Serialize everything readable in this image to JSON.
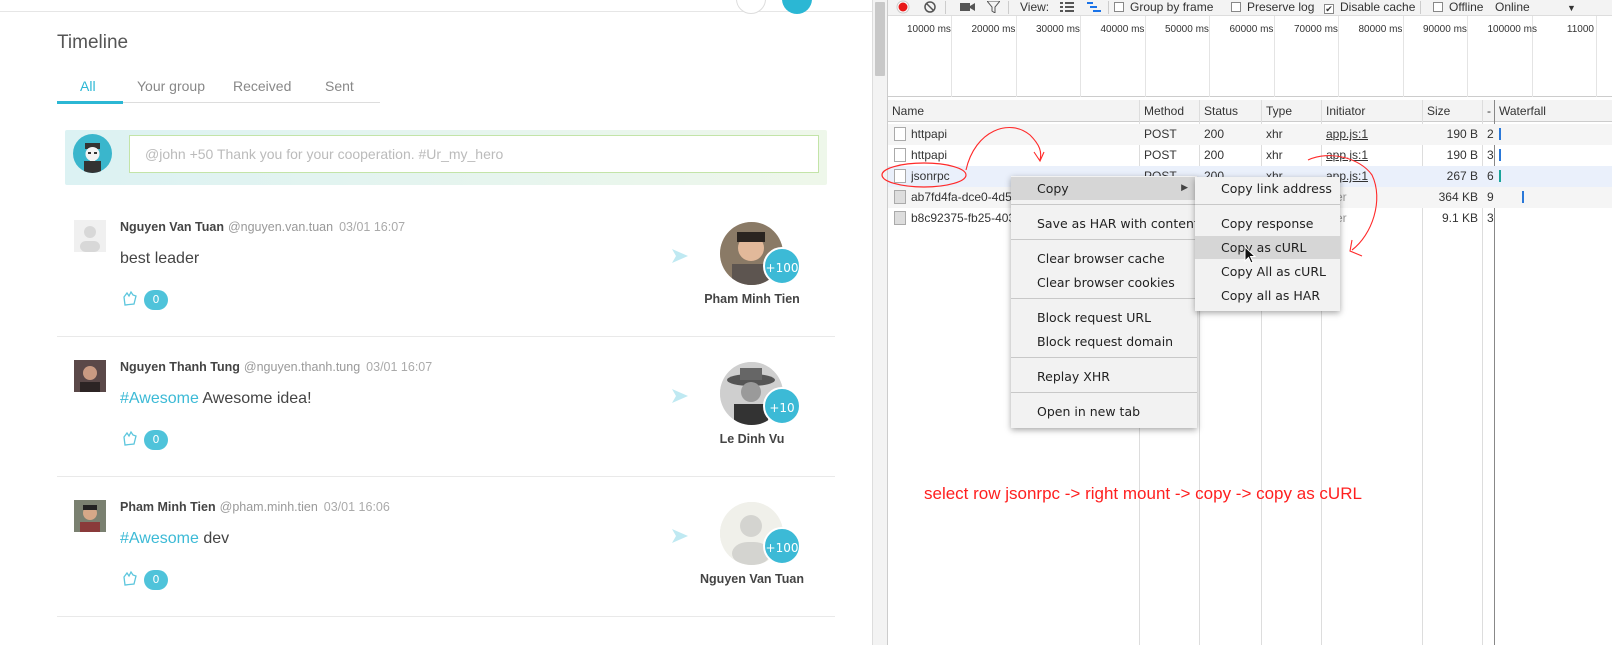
{
  "timeline": {
    "title": "Timeline",
    "tabs": [
      {
        "label": "All",
        "active": true
      },
      {
        "label": "Your group"
      },
      {
        "label": "Received"
      },
      {
        "label": "Sent"
      }
    ],
    "composer_placeholder": "@john +50 Thank you for your cooperation. #Ur_my_hero",
    "posts": [
      {
        "author": "Nguyen Van Tuan",
        "handle": "@nguyen.van.tuan",
        "time": "03/01 16:07",
        "tag": "",
        "message": "best leader",
        "claps": "0",
        "points": "+100",
        "recipient": "Pham Minh Tien"
      },
      {
        "author": "Nguyen Thanh Tung",
        "handle": "@nguyen.thanh.tung",
        "time": "03/01 16:07",
        "tag": "#Awesome",
        "message": "Awesome idea!",
        "claps": "0",
        "points": "+10",
        "recipient": "Le Dinh Vu"
      },
      {
        "author": "Pham Minh Tien",
        "handle": "@pham.minh.tien",
        "time": "03/01 16:06",
        "tag": "#Awesome",
        "message": "dev",
        "claps": "0",
        "points": "+100",
        "recipient": "Nguyen Van Tuan"
      }
    ]
  },
  "devtools": {
    "toolbar": {
      "view_label": "View:",
      "group_by_frame": "Group by frame",
      "preserve_log": "Preserve log",
      "disable_cache": "Disable cache",
      "disable_cache_checked": true,
      "offline": "Offline",
      "throttle": "Online"
    },
    "overview_ticks": [
      "10000 ms",
      "20000 ms",
      "30000 ms",
      "40000 ms",
      "50000 ms",
      "60000 ms",
      "70000 ms",
      "80000 ms",
      "90000 ms",
      "100000 ms",
      "11000"
    ],
    "columns": {
      "name": "Name",
      "method": "Method",
      "status": "Status",
      "type": "Type",
      "initiator": "Initiator",
      "size": "Size",
      "time": "-",
      "waterfall": "Waterfall"
    },
    "rows": [
      {
        "name": "httpapi",
        "method": "POST",
        "status": "200",
        "type": "xhr",
        "initiator": "app.js:1",
        "size": "190 B",
        "time": "2"
      },
      {
        "name": "httpapi",
        "method": "POST",
        "status": "200",
        "type": "xhr",
        "initiator": "app.js:1",
        "size": "190 B",
        "time": "3"
      },
      {
        "name": "jsonrpc",
        "method": "POST",
        "status": "200",
        "type": "xhr",
        "initiator": "app.js:1",
        "size": "267 B",
        "time": "6"
      },
      {
        "name": "ab7fd4fa-dce0-4d5",
        "method": "",
        "status": "",
        "type": "",
        "initiator": "ther",
        "size": "364 KB",
        "time": "9"
      },
      {
        "name": "b8c92375-fb25-403",
        "method": "",
        "status": "",
        "type": "",
        "initiator": "ther",
        "size": "9.1 KB",
        "time": "3"
      }
    ],
    "context_menu": [
      "Copy",
      "Save as HAR with content",
      "Clear browser cache",
      "Clear browser cookies",
      "Block request URL",
      "Block request domain",
      "Replay XHR",
      "Open in new tab"
    ],
    "copy_submenu": [
      "Copy link address",
      "Copy response",
      "Copy as cURL",
      "Copy All as cURL",
      "Copy all as HAR"
    ]
  },
  "annotation": "select row jsonrpc -> right mount -> copy -> copy as cURL",
  "colors": {
    "accent": "#2bb7d4",
    "annotation": "#ff1f1f",
    "record": "#e81818"
  }
}
